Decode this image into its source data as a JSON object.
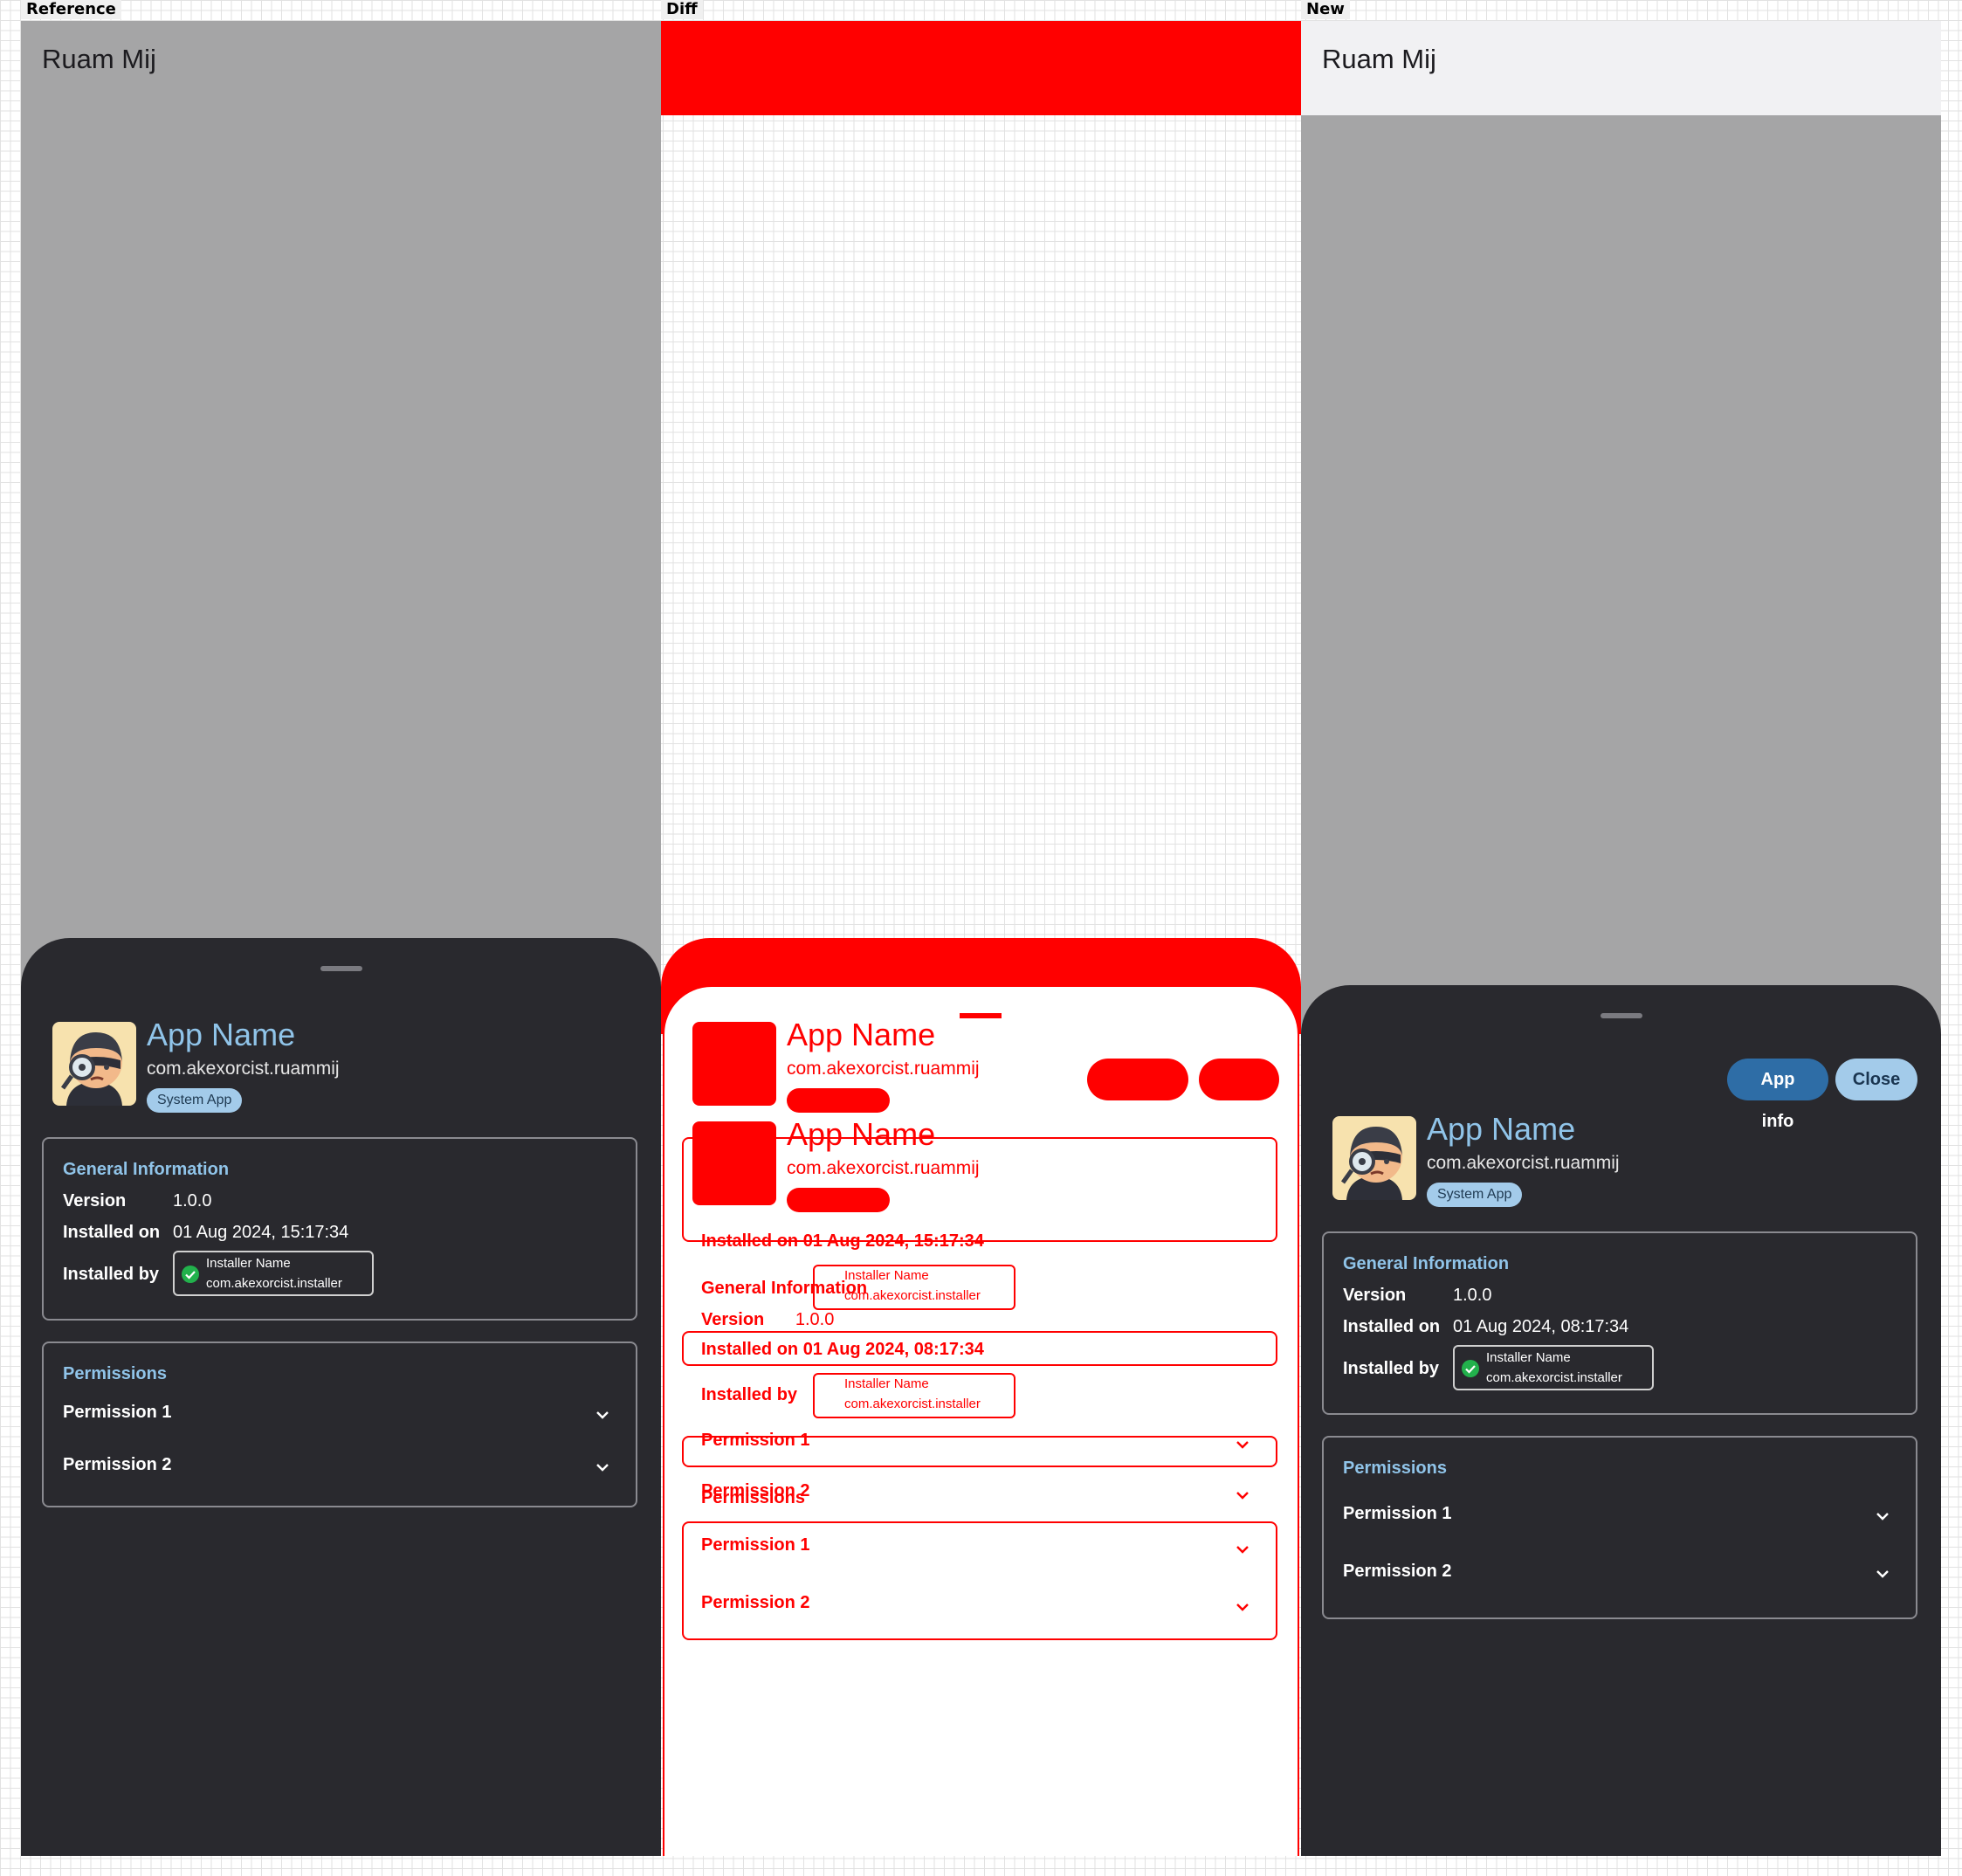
{
  "panel_labels": {
    "reference": "Reference",
    "diff": "Diff",
    "new": "New"
  },
  "app_bar": {
    "title": "Ruam Mij"
  },
  "sheet": {
    "actions": {
      "app_info": "App info",
      "close": "Close"
    },
    "app": {
      "name": "App Name",
      "package": "com.akexorcist.ruammij",
      "badge": "System App",
      "icon": "detective-avatar-icon"
    },
    "general": {
      "title": "General Information",
      "version_label": "Version",
      "version": "1.0.0",
      "installed_on_label": "Installed on",
      "installed_by_label": "Installed by",
      "installer_name": "Installer Name",
      "installer_package": "com.akexorcist.installer",
      "verified_icon": "check-circle-icon"
    },
    "permissions": {
      "title": "Permissions",
      "items": [
        {
          "label": "Permission 1"
        },
        {
          "label": "Permission 2"
        }
      ],
      "expand_icon": "chevron-down-icon"
    }
  },
  "reference": {
    "installed_on": "01 Aug 2024, 15:17:34"
  },
  "new": {
    "installed_on": "01 Aug 2024, 08:17:34"
  },
  "colors": {
    "sheet_background": "#29292e",
    "accent": "#90c4e9",
    "badge": "#a3cbea",
    "primary_button": "#2e6da6",
    "verified": "#22b14c",
    "diff": "#ff0000",
    "scrim": "#a5a5a6"
  }
}
